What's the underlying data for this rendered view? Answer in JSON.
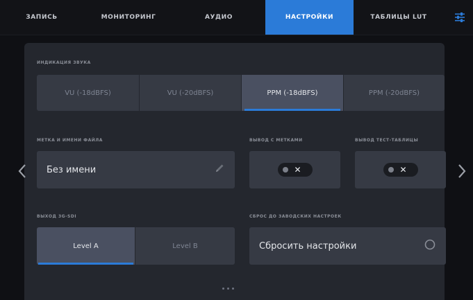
{
  "tabs": [
    {
      "label": "ЗАПИСЬ"
    },
    {
      "label": "МОНИТОРИНГ"
    },
    {
      "label": "АУДИО"
    },
    {
      "label": "НАСТРОЙКИ"
    },
    {
      "label": "ТАБЛИЦЫ LUT"
    }
  ],
  "audio_meters": {
    "section_label": "ИНДИКАЦИЯ ЗВУКА",
    "options": [
      {
        "label": "VU (-18dBFS)"
      },
      {
        "label": "VU (-20dBFS)"
      },
      {
        "label": "PPM (-18dBFS)"
      },
      {
        "label": "PPM (-20dBFS)"
      }
    ],
    "selected": "PPM (-18dBFS)"
  },
  "camera_label": {
    "section_label": "МЕТКА И ИМЕНИ ФАЙЛА",
    "value": "Без имени"
  },
  "timecode_output": {
    "section_label": "ВЫВОД С МЕТКАМИ",
    "state": "off"
  },
  "test_pattern": {
    "section_label": "ВЫВОД ТЕСТ-ТАБЛИЦЫ",
    "state": "off"
  },
  "sdi_output": {
    "section_label": "ВЫХОД 3G-SDI",
    "options": [
      {
        "label": "Level A"
      },
      {
        "label": "Level B"
      }
    ],
    "selected": "Level A"
  },
  "factory_reset": {
    "section_label": "СБРОС ДО ЗАВОДСКИХ НАСТРОЕК",
    "button_label": "Сбросить настройки"
  },
  "colors": {
    "accent": "#2b7bd8",
    "panel": "#24272e",
    "background": "#0f1014"
  }
}
